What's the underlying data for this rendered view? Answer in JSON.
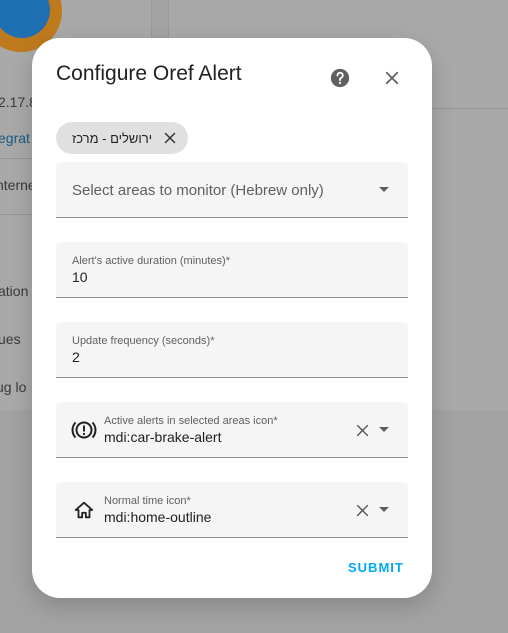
{
  "background": {
    "version_text": "2.17.8",
    "integration_link": "egrat",
    "internet_text": "nterne",
    "ation_text": "ation",
    "issues_text": "ues",
    "debug_text": "ug lo"
  },
  "dialog": {
    "title": "Configure Oref Alert",
    "selected_chip": "ירושלים - מרכז",
    "areas_select": {
      "placeholder": "Select areas to monitor (Hebrew only)"
    },
    "alert_duration": {
      "label": "Alert's active duration (minutes)*",
      "value": "10"
    },
    "update_frequency": {
      "label": "Update frequency (seconds)*",
      "value": "2"
    },
    "active_icon": {
      "label": "Active alerts in selected areas icon*",
      "value": "mdi:car-brake-alert"
    },
    "normal_icon": {
      "label": "Normal time icon*",
      "value": "mdi:home-outline"
    },
    "submit_label": "SUBMIT"
  },
  "colors": {
    "accent": "#03a9f4",
    "overlay": "#a3a3a3"
  }
}
